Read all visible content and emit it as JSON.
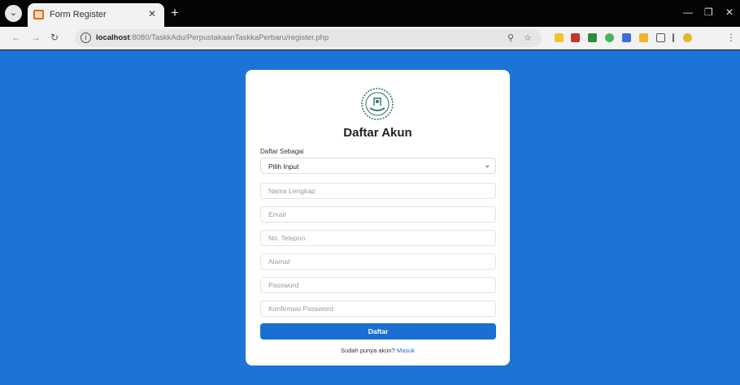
{
  "browser": {
    "tab_title": "Form Register",
    "url_host": "localhost",
    "url_path": ":8080/TaskkAdu/PerpustakaanTaskkaPerbaru/register.php",
    "icons": [
      "tab-search-icon",
      "close-icon",
      "plus-icon",
      "back-icon",
      "forward-icon",
      "reload-icon",
      "site-info-icon",
      "zoom-icon",
      "star-icon",
      "extensions-icon",
      "menu-icon"
    ],
    "window_controls": [
      "minimize-icon",
      "restore-icon",
      "close-icon"
    ]
  },
  "form": {
    "heading": "Daftar Akun",
    "role_label": "Daftar Sebagai",
    "role_selected": "Pilih Input",
    "fields": {
      "name_placeholder": "Nama Lengkap",
      "email_placeholder": "Email",
      "phone_placeholder": "No. Telepon",
      "address_placeholder": "Alamat",
      "password_placeholder": "Password",
      "confirm_placeholder": "Konfirmasi Password"
    },
    "submit_label": "Daftar",
    "footer_text": "Sudah punya akun? ",
    "footer_link": "Masuk"
  },
  "colors": {
    "page_background": "#1b74d6",
    "button": "#1a6fd2",
    "card": "#ffffff"
  }
}
